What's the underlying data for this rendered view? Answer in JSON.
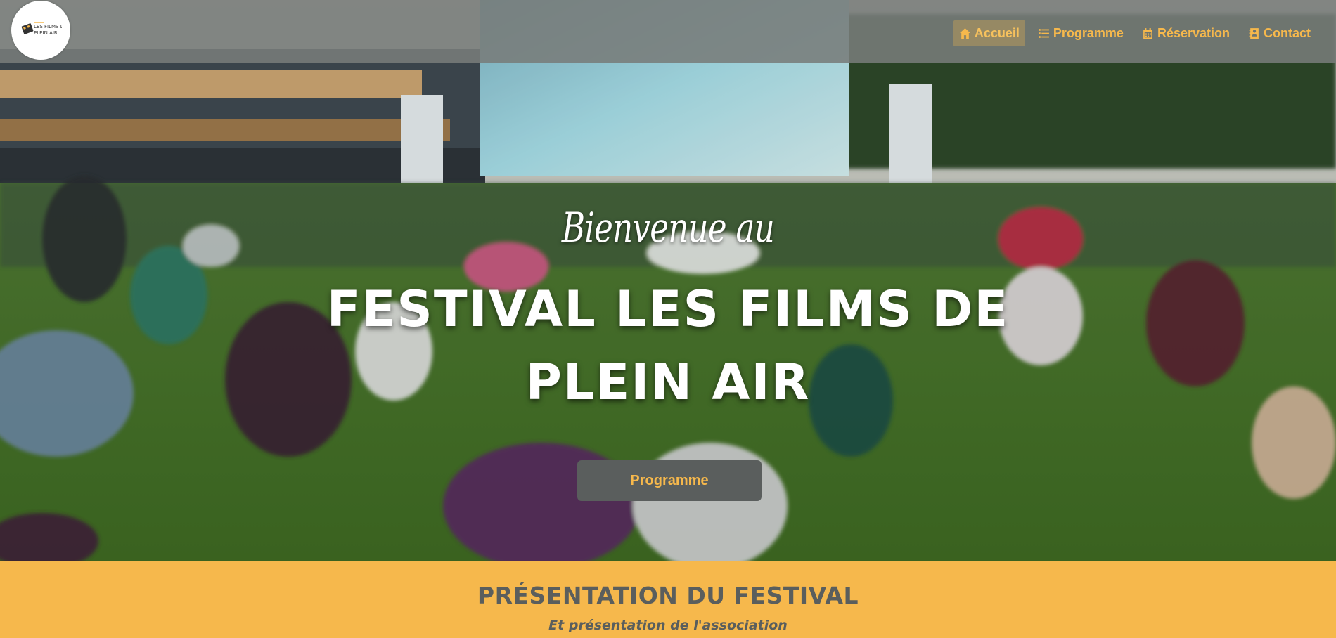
{
  "logo": {
    "text_line1": "LES FILMS DE",
    "text_line2": "PLEIN AIR"
  },
  "nav": {
    "items": [
      {
        "label": "Accueil",
        "icon": "home-icon",
        "active": true
      },
      {
        "label": "Programme",
        "icon": "list-icon",
        "active": false
      },
      {
        "label": "Réservation",
        "icon": "calendar-icon",
        "active": false
      },
      {
        "label": "Contact",
        "icon": "contact-card-icon",
        "active": false
      }
    ]
  },
  "hero": {
    "welcome": "Bienvenue au",
    "title": "FESTIVAL LES FILMS DE PLEIN AIR",
    "button_label": "Programme"
  },
  "presentation": {
    "title": "PRÉSENTATION DU FESTIVAL",
    "subtitle": "Et présentation de l'association"
  },
  "colors": {
    "accent": "#f6b84c",
    "dark": "#5a5e5d",
    "navbar": "#787c7a"
  }
}
